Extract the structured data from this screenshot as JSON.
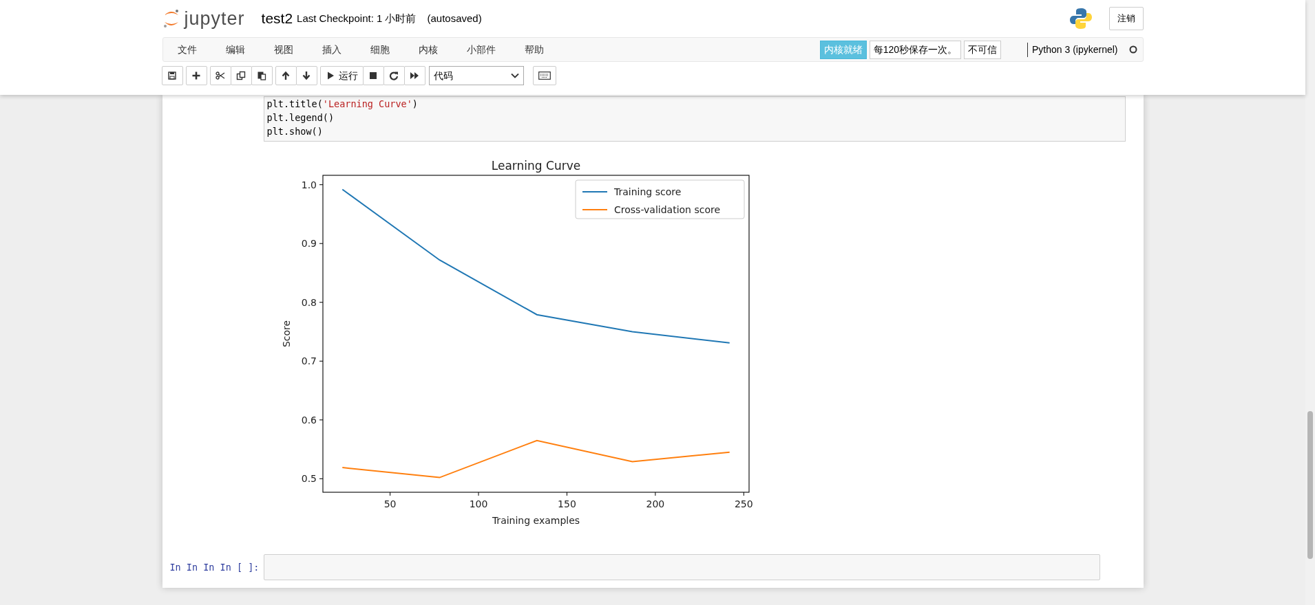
{
  "header": {
    "logo_text": "jupyter",
    "notebook_name": "test2",
    "checkpoint": "Last Checkpoint: 1 小时前",
    "autosave": "(autosaved)",
    "logout_button": "注销"
  },
  "menu": [
    "文件",
    "编辑",
    "视图",
    "插入",
    "细胞",
    "内核",
    "小部件",
    "帮助"
  ],
  "indicators": {
    "kernel_status": "内核就绪",
    "autosave_note": "每120秒保存一次。",
    "trust": "不可信",
    "kernel_name": "Python 3 (ipykernel)",
    "kernel_busy": false
  },
  "toolbar": {
    "groups": [
      [
        {
          "kind": "save"
        }
      ],
      [
        {
          "kind": "insert"
        }
      ],
      [
        {
          "kind": "cut"
        },
        {
          "kind": "copy"
        },
        {
          "kind": "paste"
        }
      ],
      [
        {
          "kind": "move-up"
        },
        {
          "kind": "move-down"
        }
      ],
      [
        {
          "kind": "run",
          "label": "运行"
        },
        {
          "kind": "stop"
        },
        {
          "kind": "restart"
        },
        {
          "kind": "run-all"
        }
      ]
    ],
    "cell_type": "代码"
  },
  "cells": [
    {
      "kind": "code",
      "lines": [
        [
          {
            "kind": "plain",
            "text": "plt.title("
          },
          {
            "kind": "string",
            "text": "'Learning Curve'"
          },
          {
            "kind": "plain",
            "text": ")"
          }
        ],
        [
          {
            "kind": "plain",
            "text": "plt.legend()"
          }
        ],
        [
          {
            "kind": "plain",
            "text": "plt.show()"
          }
        ]
      ],
      "output": {
        "chart_data": {
          "type": "line",
          "title": "Learning Curve",
          "xlabel": "Training examples",
          "ylabel": "Score",
          "x": [
            23,
            78,
            133,
            187,
            242
          ],
          "series": [
            {
              "name": "Training score",
              "color": "#1f77b4",
              "values": [
                0.992,
                0.872,
                0.779,
                0.75,
                0.731
              ]
            },
            {
              "name": "Cross-validation score",
              "color": "#ff7f0e",
              "values": [
                0.519,
                0.502,
                0.565,
                0.529,
                0.545
              ]
            }
          ],
          "legend": "upper right",
          "xlim": [
            12,
            253
          ],
          "ylim": [
            0.477,
            1.016
          ],
          "xticks": [
            50,
            100,
            150,
            200,
            250
          ],
          "yticks": [
            {
              "value": 0.5,
              "label": "0.5"
            },
            {
              "value": 0.6,
              "label": "0.6"
            },
            {
              "value": 0.7,
              "label": "0.7"
            },
            {
              "value": 0.8,
              "label": "0.8"
            },
            {
              "value": 0.9,
              "label": "0.9"
            },
            {
              "value": 1.0,
              "label": "1.0"
            }
          ]
        }
      }
    },
    {
      "kind": "empty",
      "prompt": "In In In In [ ]:"
    }
  ]
}
